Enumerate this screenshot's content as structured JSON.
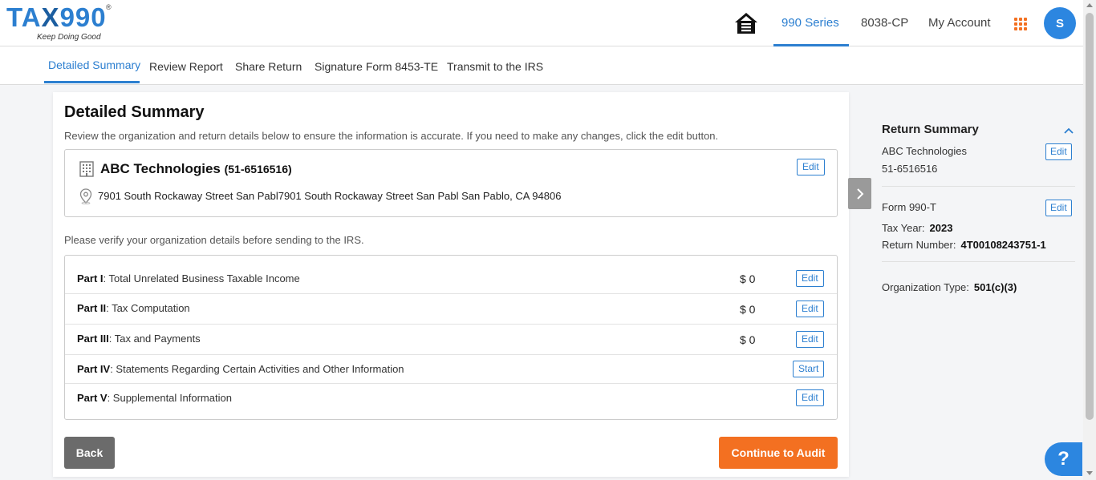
{
  "brand": {
    "logo_prefix": "TA",
    "logo_x": "X",
    "logo_suffix": "990",
    "registered": "®",
    "tagline": "Keep Doing Good"
  },
  "topnav": {
    "items": [
      {
        "label": "990 Series",
        "active": true
      },
      {
        "label": "8038-CP",
        "active": false
      },
      {
        "label": "My Account",
        "active": false
      }
    ],
    "avatar_initial": "S"
  },
  "subnav": {
    "tabs": [
      {
        "label": "Detailed Summary",
        "active": true
      },
      {
        "label": "Review Report"
      },
      {
        "label": "Share Return"
      },
      {
        "label": "Signature Form 8453-TE"
      },
      {
        "label": "Transmit to the IRS"
      }
    ]
  },
  "main": {
    "title": "Detailed Summary",
    "description": "Review the organization and return details below to ensure the information is accurate. If you need to make any changes, click the edit button.",
    "organization": {
      "name": "ABC Technologies",
      "ein_display": "(51-6516516)",
      "address": "7901 South Rockaway Street San Pabl7901 South Rockaway Street San Pabl San Pablo, CA 94806",
      "edit_label": "Edit"
    },
    "verify_text": "Please verify your organization details before sending to the IRS.",
    "parts": [
      {
        "part": "Part I",
        "label": ": Total Unrelated Business Taxable Income",
        "amount": "$ 0",
        "action": "Edit"
      },
      {
        "part": "Part II",
        "label": ": Tax Computation",
        "amount": "$ 0",
        "action": "Edit"
      },
      {
        "part": "Part III",
        "label": ": Tax and Payments",
        "amount": "$ 0",
        "action": "Edit"
      },
      {
        "part": "Part IV",
        "label": ": Statements Regarding Certain Activities and Other Information",
        "amount": "",
        "action": "Start"
      },
      {
        "part": "Part V",
        "label": ": Supplemental Information",
        "amount": "",
        "action": "Edit"
      }
    ],
    "back_label": "Back",
    "continue_label": "Continue to Audit"
  },
  "summary": {
    "title": "Return Summary",
    "org_name": "ABC Technologies",
    "org_ein": "51-6516516",
    "form_name": "Form 990-T",
    "tax_year_label": "Tax Year:",
    "tax_year": "2023",
    "return_number_label": "Return Number:",
    "return_number": "4T00108243751-1",
    "org_type_label": "Organization Type:",
    "org_type": "501(c)(3)",
    "edit_label": "Edit"
  },
  "help": {
    "label": "?"
  },
  "colors": {
    "primary": "#2c7fd0",
    "accent": "#f37021",
    "back_button": "#6b6b6b"
  }
}
